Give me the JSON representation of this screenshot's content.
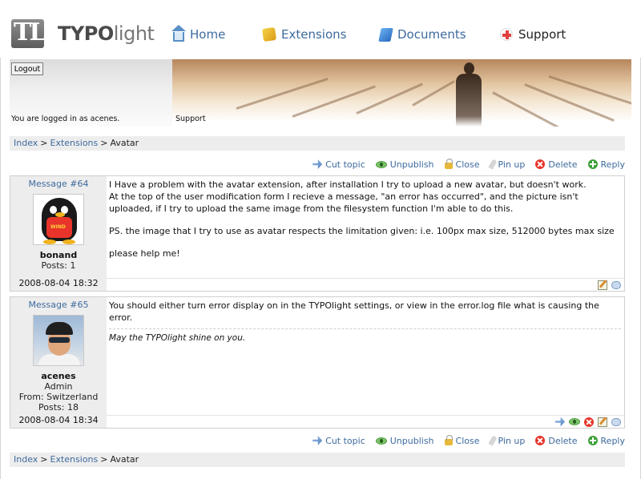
{
  "brand": {
    "logo_mark": "TL",
    "name_bold": "TYPO",
    "name_light": "light"
  },
  "nav": [
    {
      "label": "Home",
      "icon": "home-icon"
    },
    {
      "label": "Extensions",
      "icon": "extensions-icon"
    },
    {
      "label": "Documents",
      "icon": "documents-icon"
    },
    {
      "label": "Support",
      "icon": "support-icon"
    }
  ],
  "login": {
    "logout_label": "Logout",
    "status": "You are logged in as acenes."
  },
  "banner": {
    "label": "Support"
  },
  "breadcrumb": {
    "items": [
      "Index",
      "Extensions"
    ],
    "current": "Avatar",
    "separator": ">"
  },
  "actions": {
    "cut_topic": "Cut topic",
    "unpublish": "Unpublish",
    "close": "Close",
    "pin_up": "Pin up",
    "delete": "Delete",
    "reply": "Reply"
  },
  "posts": [
    {
      "number": "Message #64",
      "avatar": "penguin-avatar",
      "avatar_text": "WIND",
      "username": "bonand",
      "meta": [
        "Posts: 1"
      ],
      "date": "2008-08-04 18:32",
      "paragraphs": [
        "I Have a problem with the avatar extension, after installation I try to upload a new avatar, but doesn't work.\nAt the top of the user modification form I recieve a message, \"an error has occurred\", and the picture isn't uploaded, if I try to upload the same image from the filesystem function I'm able to do this.",
        "PS. the image that I try to use as avatar respects the limitation given: i.e. 100px max size, 512000 bytes max size",
        "please help me!"
      ],
      "signature": ""
    },
    {
      "number": "Message #65",
      "avatar": "photo-avatar",
      "username": "acenes",
      "meta": [
        "Admin",
        "From: Switzerland",
        "Posts: 18"
      ],
      "date": "2008-08-04 18:34",
      "paragraphs": [
        "You should either turn error display on in the TYPOlight settings, or view in the error.log file what is causing the error."
      ],
      "signature": "May the TYPOlight shine on you."
    }
  ],
  "colors": {
    "link": "#3d6a9e",
    "panel": "#ededed",
    "border": "#cfcfcf"
  }
}
